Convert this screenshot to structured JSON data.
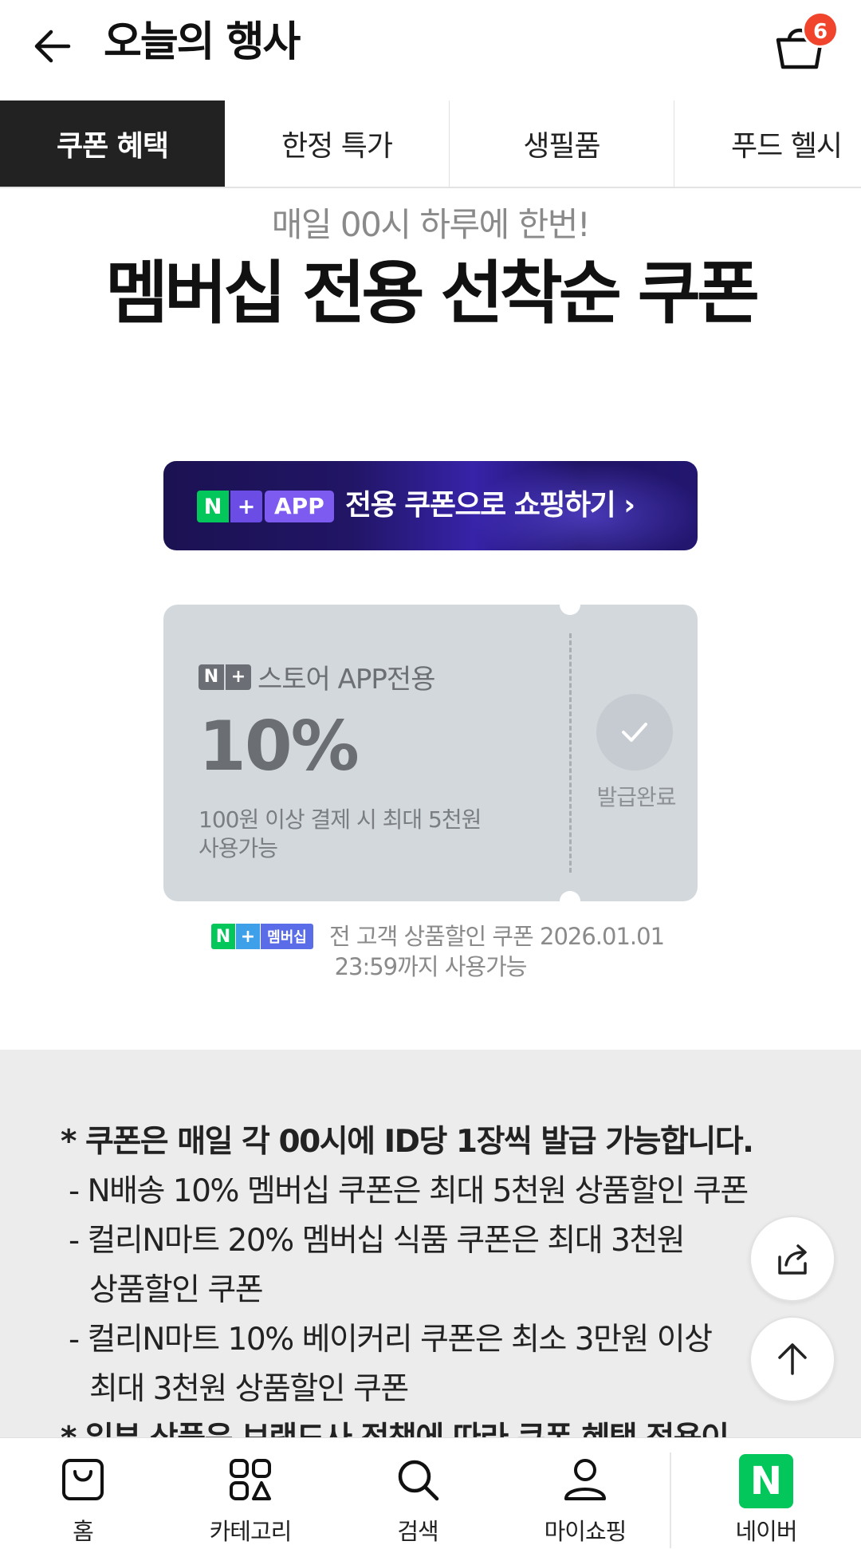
{
  "header": {
    "title": "오늘의 행사",
    "cart_badge": "6"
  },
  "tabs": [
    {
      "label": "쿠폰 혜택",
      "active": true
    },
    {
      "label": "한정 특가",
      "active": false
    },
    {
      "label": "생필품",
      "active": false
    },
    {
      "label": "푸드 헬시",
      "active": false
    }
  ],
  "hero": {
    "subtitle": "매일 00시 하루에 한번!",
    "title": "멤버십 전용 선착순 쿠폰"
  },
  "app_banner": {
    "logo_n": "N",
    "logo_plus": "+",
    "chip": "APP",
    "text": "전용 쿠폰으로 쇼핑하기 ›"
  },
  "coupon": {
    "logo_n": "N",
    "logo_plus": "+",
    "label": "스토어 APP전용",
    "value": "10%",
    "desc_line1": "100원 이상 결제 시 최대 5천원",
    "desc_line2": "사용가능",
    "status": "발급완료"
  },
  "membership_note": {
    "badge_n": "N",
    "badge_plus": "+",
    "badge_text": "멤버십",
    "line1": "전 고객 상품할인 쿠폰 2026.01.01",
    "line2": "23:59까지 사용가능"
  },
  "info_lines": [
    "* 쿠폰은 매일 각 00시에 ID당 1장씩 발급 가능합니다.",
    "- N배송 10% 멤버십 쿠폰은 최대 5천원 상품할인 쿠폰",
    "- 컬리N마트 20% 멤버십 식품 쿠폰은 최대 3천원",
    "상품할인 쿠폰",
    "- 컬리N마트 10% 베이커리 쿠폰은 최소 3만원 이상",
    "최대 3천원 상품할인 쿠폰",
    "* 일부 상품은 브랜드사 정책에 따라 쿠폰 혜택 적용이"
  ],
  "bottom_nav": {
    "home": "홈",
    "category": "카테고리",
    "search": "검색",
    "my_shopping": "마이쇼핑",
    "naver": "네이버",
    "naver_logo": "N"
  },
  "colors": {
    "accent_green": "#03c75a",
    "badge_red": "#f0442c",
    "active_tab_bg": "#222222",
    "coupon_bg": "#d3d8dd",
    "banner_bg": "#211565"
  }
}
